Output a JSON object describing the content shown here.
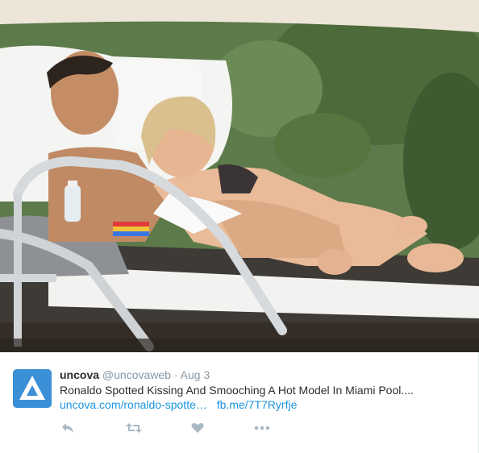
{
  "tweet": {
    "author": {
      "name": "uncova",
      "handle": "@uncovaweb",
      "separator": "·",
      "date": "Aug 3"
    },
    "text": "Ronaldo Spotted Kissing And Smooching A Hot Model In Miami Pool....",
    "links": [
      "uncova.com/ronaldo-spotte…",
      "fb.me/7T7Ryrfje"
    ],
    "colors": {
      "link": "#1b95e0",
      "avatar_bg": "#3b8fd6",
      "action_icon": "#aab8c2"
    },
    "actions": [
      "reply-icon",
      "retweet-icon",
      "like-icon",
      "more-icon"
    ]
  }
}
